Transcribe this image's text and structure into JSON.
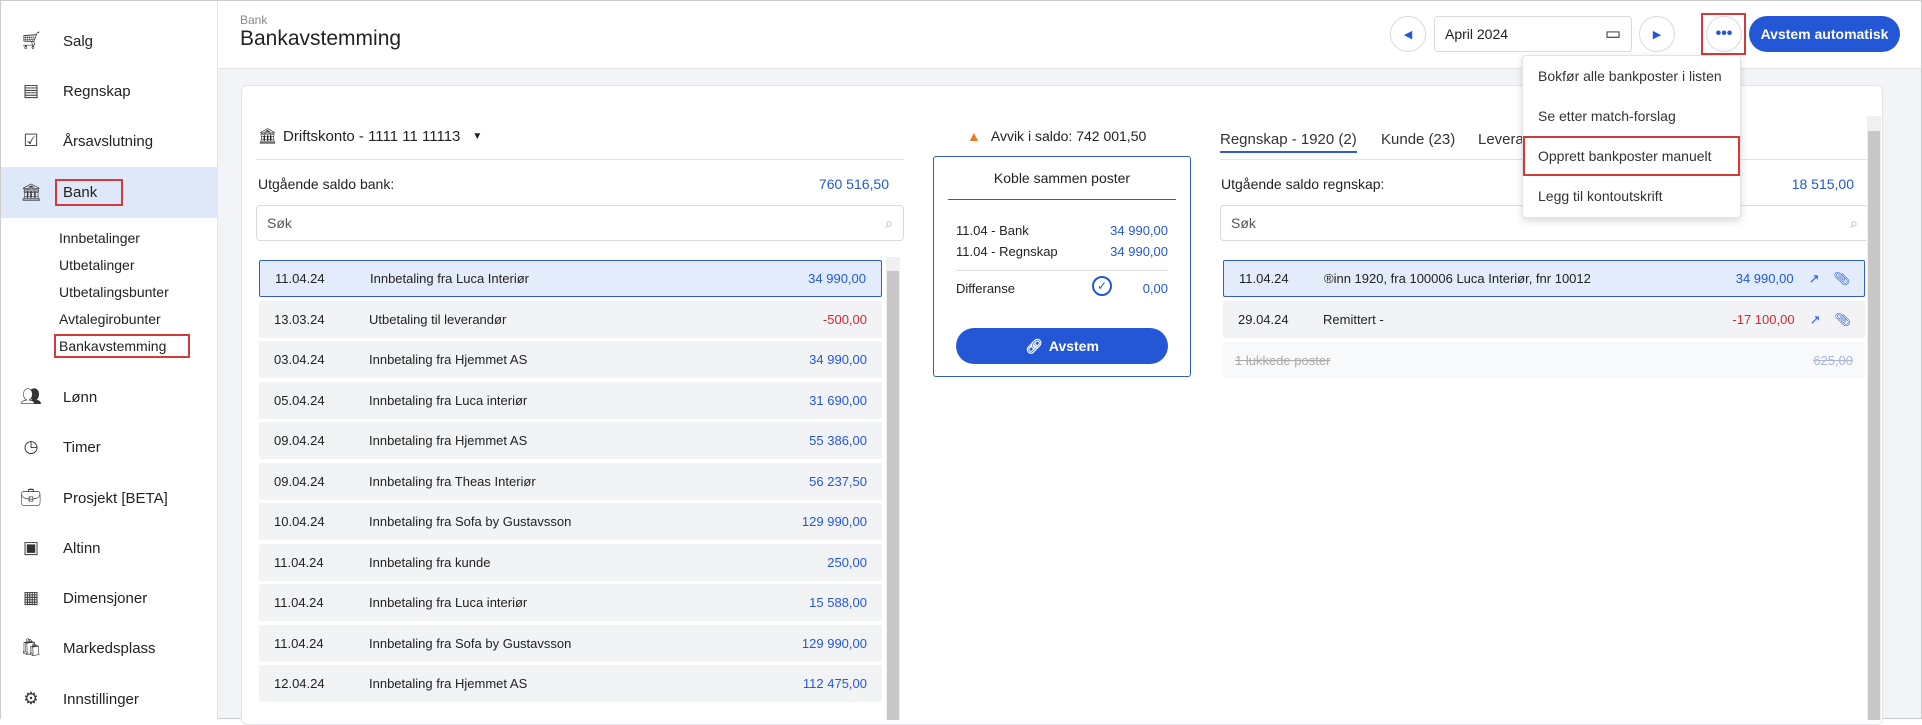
{
  "sidebar": {
    "items": [
      {
        "label": "Salg",
        "icon": "cart-icon"
      },
      {
        "label": "Regnskap",
        "icon": "document-icon"
      },
      {
        "label": "Årsavslutning",
        "icon": "calendar-check-icon"
      },
      {
        "label": "Bank",
        "icon": "bank-icon"
      },
      {
        "label": "Lønn",
        "icon": "people-icon"
      },
      {
        "label": "Timer",
        "icon": "clock-icon"
      },
      {
        "label": "Prosjekt [BETA]",
        "icon": "briefcase-icon"
      },
      {
        "label": "Altinn",
        "icon": "square-icon"
      },
      {
        "label": "Dimensjoner",
        "icon": "grid-icon"
      },
      {
        "label": "Markedsplass",
        "icon": "bag-icon"
      },
      {
        "label": "Innstillinger",
        "icon": "gear-icon"
      }
    ],
    "bank_sub": [
      "Innbetalinger",
      "Utbetalinger",
      "Utbetalingsbunter",
      "Avtalegirobunter",
      "Bankavstemming"
    ]
  },
  "header": {
    "breadcrumb": "Bank",
    "title": "Bankavstemming",
    "period": "April 2024",
    "auto_button": "Avstem automatisk",
    "menu": [
      "Bokfør alle bankposter i listen",
      "Se etter match-forslag",
      "Opprett bankposter manuelt",
      "Legg til kontoutskrift"
    ]
  },
  "bank": {
    "account": "Driftskonto - 1111 11 11113",
    "balance_label": "Utgående saldo bank:",
    "balance": "760 516,50",
    "search_placeholder": "Søk",
    "rows": [
      {
        "date": "11.04.24",
        "text": "Innbetaling fra Luca Interiør",
        "amount": "34 990,00"
      },
      {
        "date": "13.03.24",
        "text": "Utbetaling til leverandør",
        "amount": "-500,00"
      },
      {
        "date": "03.04.24",
        "text": "Innbetaling fra Hjemmet AS",
        "amount": "34 990,00"
      },
      {
        "date": "05.04.24",
        "text": "Innbetaling fra Luca interiør",
        "amount": "31 690,00"
      },
      {
        "date": "09.04.24",
        "text": "Innbetaling fra Hjemmet AS",
        "amount": "55 386,00"
      },
      {
        "date": "09.04.24",
        "text": "Innbetaling fra Theas Interiør",
        "amount": "56 237,50"
      },
      {
        "date": "10.04.24",
        "text": "Innbetaling fra Sofa by Gustavsson",
        "amount": "129 990,00"
      },
      {
        "date": "11.04.24",
        "text": "Innbetaling fra kunde",
        "amount": "250,00"
      },
      {
        "date": "11.04.24",
        "text": "Innbetaling fra Luca interiør",
        "amount": "15 588,00"
      },
      {
        "date": "11.04.24",
        "text": "Innbetaling fra Sofa by Gustavsson",
        "amount": "129 990,00"
      },
      {
        "date": "12.04.24",
        "text": "Innbetaling fra Hjemmet AS",
        "amount": "112 475,00"
      }
    ]
  },
  "match": {
    "deviation": "Avvik i saldo: 742 001,50",
    "title": "Koble sammen poster",
    "bank_label": "11.04 - Bank",
    "bank_amount": "34 990,00",
    "ledger_label": "11.04 - Regnskap",
    "ledger_amount": "34 990,00",
    "diff_label": "Differanse",
    "diff_amount": "0,00",
    "button": "Avstem"
  },
  "ledger": {
    "tabs": [
      "Regnskap - 1920 (2)",
      "Kunde (23)",
      "Levera"
    ],
    "balance_label": "Utgående saldo regnskap:",
    "balance": "18 515,00",
    "search_placeholder": "Søk",
    "rows": [
      {
        "date": "11.04.24",
        "text": "®inn 1920, fra 100006 Luca Interiør, fnr 10012",
        "amount": "34 990,00"
      },
      {
        "date": "29.04.24",
        "text": "Remittert -",
        "amount": "-17 100,00"
      }
    ],
    "closed_label": "1 lukkede poster",
    "closed_amount": "625,00"
  }
}
